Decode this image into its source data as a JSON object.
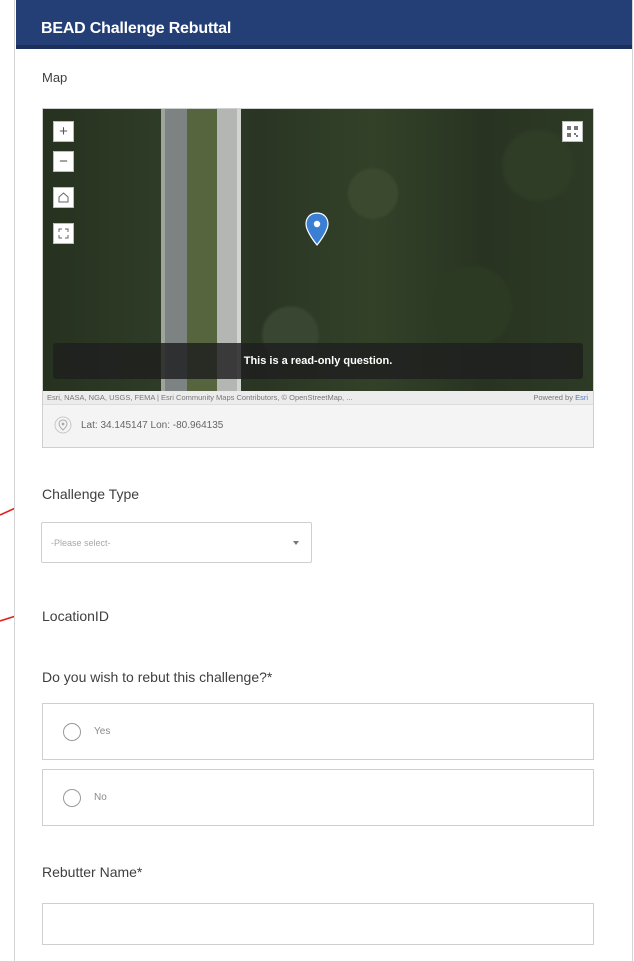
{
  "header": {
    "title": "BEAD Challenge Rebuttal"
  },
  "map_question": {
    "label": "Map",
    "zoom_in_icon": "+",
    "zoom_out_icon": "−",
    "readonly_banner": "This is a read-only question.",
    "attribution": "Esri, NASA, NGA, USGS, FEMA | Esri Community Maps Contributors, © OpenStreetMap, ...",
    "powered_by_prefix": "Powered by",
    "powered_by_brand": "Esri",
    "coordinates": "Lat: 34.145147  Lon: -80.964135"
  },
  "challenge_type": {
    "label": "Challenge Type",
    "selected": "-Please select-"
  },
  "location_id": {
    "label": "LocationID"
  },
  "rebut_question": {
    "label": "Do you wish to rebut this challenge?*",
    "options": [
      "Yes",
      "No"
    ]
  },
  "rebutter_name": {
    "label": "Rebutter Name*",
    "value": ""
  },
  "colors": {
    "header_bg": "#243f76",
    "annotation_arrow": "#e02020",
    "pin": "#3b7fd4"
  }
}
